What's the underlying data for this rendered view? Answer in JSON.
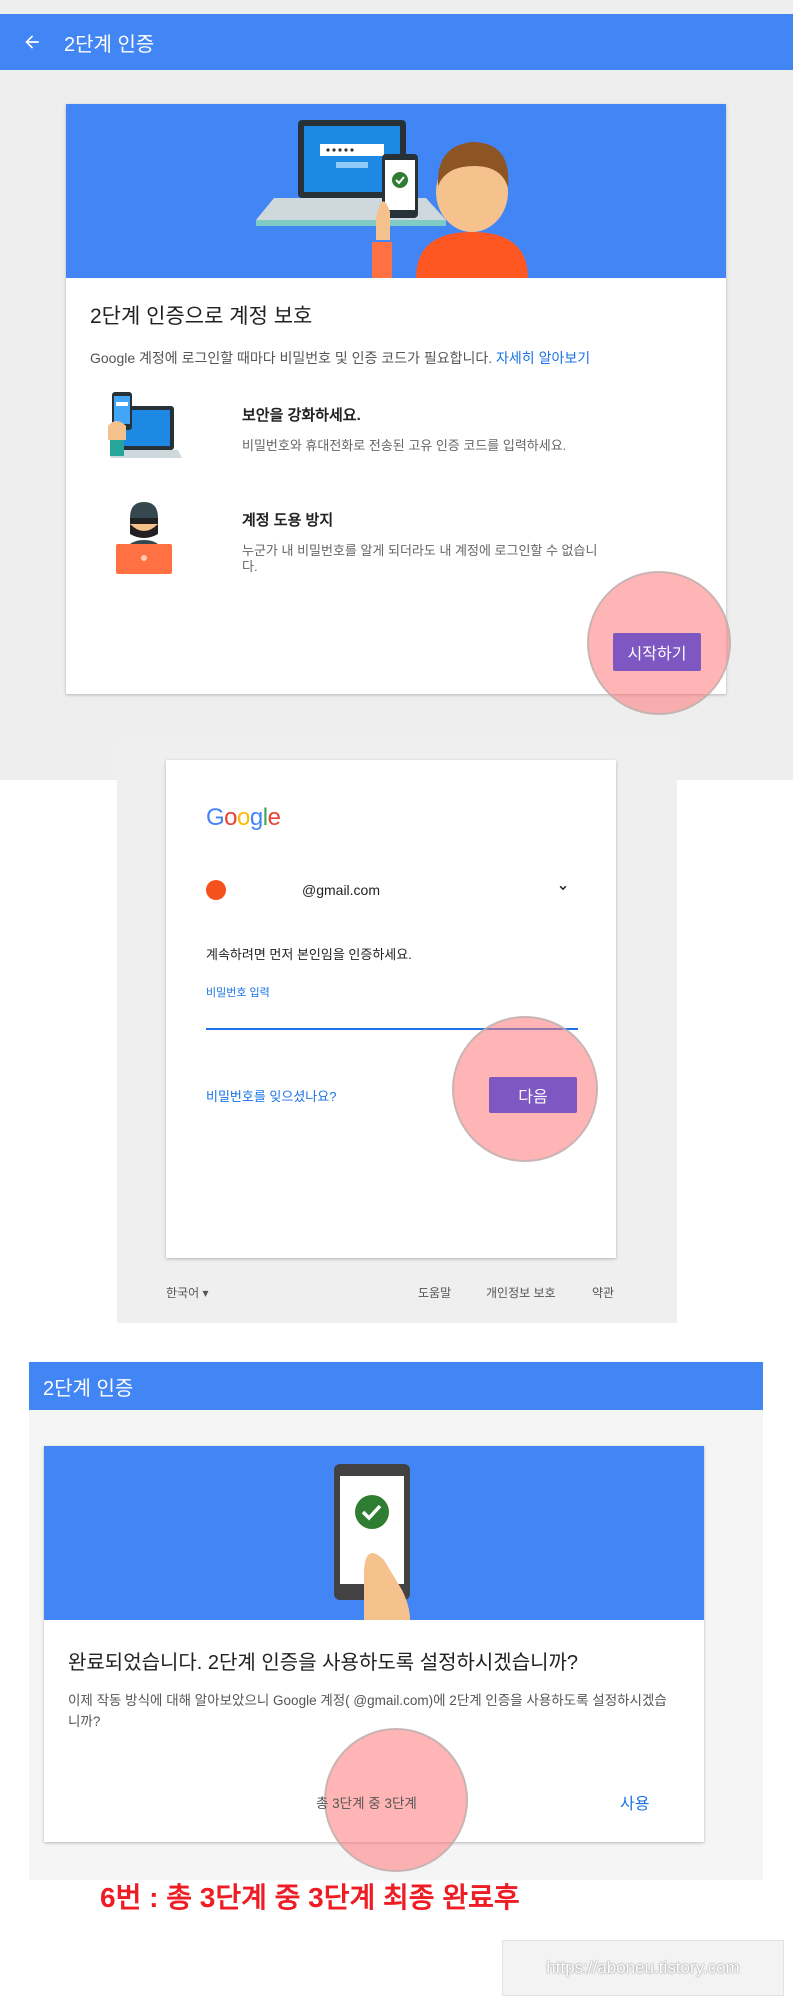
{
  "section1": {
    "title": "2단계 인증",
    "heading": "2단계 인증으로 계정 보호",
    "description": "Google 계정에 로그인할 때마다 비밀번호 및 인증 코드가 필요합니다. ",
    "learn_more": "자세히 알아보기",
    "features": [
      {
        "title": "보안을 강화하세요.",
        "body": "비밀번호와 휴대전화로 전송된 고유 인증 코드를 입력하세요."
      },
      {
        "title": "계정 도용 방지",
        "body": "누군가 내 비밀번호를 알게 되더라도 내 계정에 로그인할 수 없습니다."
      }
    ],
    "start_button": "시작하기"
  },
  "section2": {
    "logo": [
      "G",
      "o",
      "o",
      "g",
      "l",
      "e"
    ],
    "logo_colors": [
      "#4285f4",
      "#ea4335",
      "#fbbc05",
      "#4285f4",
      "#34a853",
      "#ea4335"
    ],
    "email": "@gmail.com",
    "verify_text": "계속하려면 먼저 본인임을 인증하세요.",
    "password_label": "비밀번호 입력",
    "forgot": "비밀번호를 잊으셨나요?",
    "next_button": "다음",
    "footer": {
      "language": "한국어",
      "help": "도움말",
      "privacy": "개인정보 보호",
      "terms": "약관"
    }
  },
  "section3": {
    "title": "2단계 인증",
    "question": "완료되었습니다. 2단계 인증을 사용하도록 설정하시겠습니까?",
    "paragraph": "이제 작동 방식에 대해 알아보았으니 Google 계정(                    @gmail.com)에 2단계 인증을 사용하도록 설정하시겠습니까?",
    "step": "총 3단계 중 3단계",
    "use_button": "사용"
  },
  "caption": "6번 : 총 3단계 중 3단계 최종 완료후",
  "watermark": "https://aboneu.tistory.com",
  "colors": {
    "primary": "#4285f4",
    "button": "#7e57c2",
    "caption": "#ee1c24"
  }
}
